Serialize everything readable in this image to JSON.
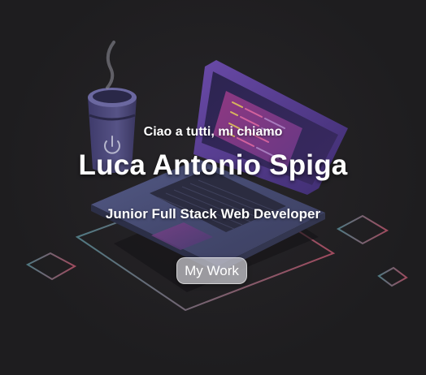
{
  "hero": {
    "greeting": "Ciao a tutti, mi chiamo",
    "name": "Luca Antonio Spiga",
    "role": "Junior Full Stack Web Developer",
    "cta_label": "My Work"
  },
  "colors": {
    "background": "#1f1e20",
    "laptop_purple": "#5b3f9a",
    "screen_dark": "#2a2446",
    "outline_pink": "#c0566e",
    "outline_teal": "#5c8f9a",
    "text": "#ffffff"
  },
  "icons": {
    "cup_logo": "power-icon"
  }
}
